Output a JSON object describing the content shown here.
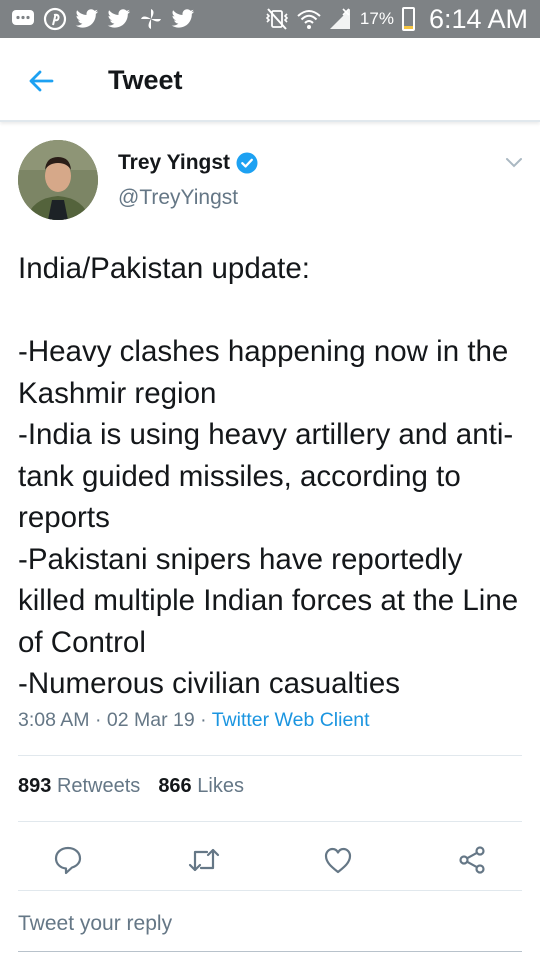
{
  "status_bar": {
    "battery_percent_label": "17%",
    "battery_level": 0.17,
    "time": "6:14 AM",
    "notification_icons": [
      "message-icon",
      "pinterest-icon",
      "twitter-bird-icon",
      "twitter-bird-icon",
      "pinwheel-icon",
      "twitter-bird-icon"
    ],
    "system_icons": [
      "vibrate-off-icon",
      "wifi-icon",
      "signal-icon",
      "battery-icon"
    ],
    "background": "#7e8285"
  },
  "header": {
    "title": "Tweet",
    "back_icon": "arrow-left-icon"
  },
  "tweet": {
    "author_name": "Trey Yingst",
    "verified": true,
    "handle": "@TreyYingst",
    "text": "India/Pakistan update:\n\n-Heavy clashes happening now in the Kashmir region\n-India is using heavy artillery and anti-tank guided missiles, according to reports\n-Pakistani snipers have reportedly killed multiple Indian forces at the Line of Control\n-Numerous civilian casualties",
    "time": "3:08 AM",
    "separator": "·",
    "date": "02 Mar 19",
    "client": "Twitter Web Client",
    "retweets_count": "893",
    "retweets_label": "Retweets",
    "likes_count": "866",
    "likes_label": "Likes"
  },
  "actions": [
    "reply-icon",
    "retweet-icon",
    "like-icon",
    "share-icon"
  ],
  "reply": {
    "placeholder": "Tweet your reply"
  },
  "colors": {
    "accent": "#1da1f2",
    "link": "#1b95e0",
    "secondary_text": "#657786",
    "divider": "#e1e8ed"
  }
}
